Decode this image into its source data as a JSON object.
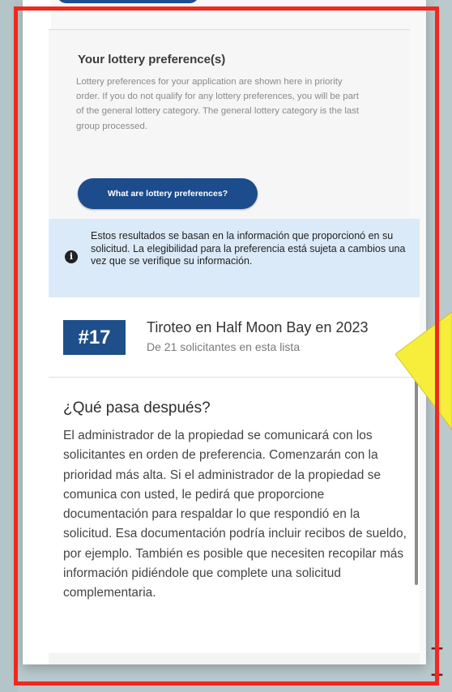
{
  "preferences": {
    "title": "Your lottery preference(s)",
    "description": "Lottery preferences for your application are shown here in priority order. If you do not qualify for any lottery preferences, you will be part of the general lottery category. The general lottery category is the last group processed.",
    "button_label": "What are lottery preferences?"
  },
  "alert": {
    "icon": "info-icon",
    "text": "Estos resultados se basan en la información que proporcionó en su solicitud. La elegibilidad para la preferencia está sujeta a cambios una vez que se verifique su información."
  },
  "result": {
    "rank": "#17",
    "title": "Tiroteo en Half Moon Bay en 2023",
    "subtitle": "De 21 solicitantes en esta lista"
  },
  "next_steps": {
    "title": "¿Qué pasa después?",
    "body": "El administrador de la propiedad se comunicará con los solicitantes en orden de preferencia. Comenzarán con la prioridad más alta. Si el administrador de la propiedad se comunica con usted, le pedirá que proporcione documentación para respaldar lo que respondió en la solicitud. Esa documentación podría incluir recibos de sueldo, por ejemplo. También es posible que necesiten recopilar más información pidiéndole que complete una solicitud complementaria."
  },
  "colors": {
    "frame": "#f0281e",
    "primary_button": "#1c4c8c",
    "alert_bg": "#dbeaf8",
    "highlight_arrow": "#f7ee3c"
  }
}
